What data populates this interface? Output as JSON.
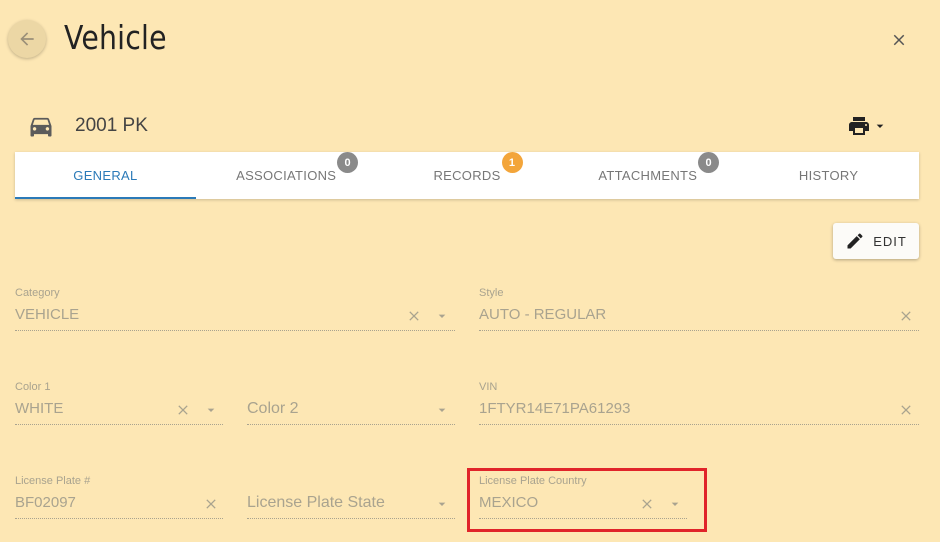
{
  "header": {
    "title": "Vehicle"
  },
  "vehicle": {
    "name": "2001 PK"
  },
  "tabs": [
    {
      "label": "GENERAL",
      "badge": ""
    },
    {
      "label": "ASSOCIATIONS",
      "badge": "0"
    },
    {
      "label": "RECORDS",
      "badge": "1"
    },
    {
      "label": "ATTACHMENTS",
      "badge": "0"
    },
    {
      "label": "HISTORY",
      "badge": ""
    }
  ],
  "toolbar": {
    "edit_label": "EDIT"
  },
  "fields": {
    "category": {
      "label": "Category",
      "value": "VEHICLE"
    },
    "style": {
      "label": "Style",
      "value": "AUTO - REGULAR"
    },
    "color1": {
      "label": "Color 1",
      "value": "WHITE"
    },
    "color2": {
      "placeholder": "Color 2"
    },
    "vin": {
      "label": "VIN",
      "value": "1FTYR14E71PA61293"
    },
    "plate": {
      "label": "License Plate #",
      "value": "BF02097"
    },
    "plate_state": {
      "placeholder": "License Plate State"
    },
    "plate_country": {
      "label": "License Plate Country",
      "value": "MEXICO"
    }
  },
  "colors": {
    "background": "#fde7b4",
    "accent": "#2b7ab8",
    "badge_grey": "#8a8a8a",
    "badge_orange": "#f3a53a",
    "highlight": "#e0242a"
  }
}
